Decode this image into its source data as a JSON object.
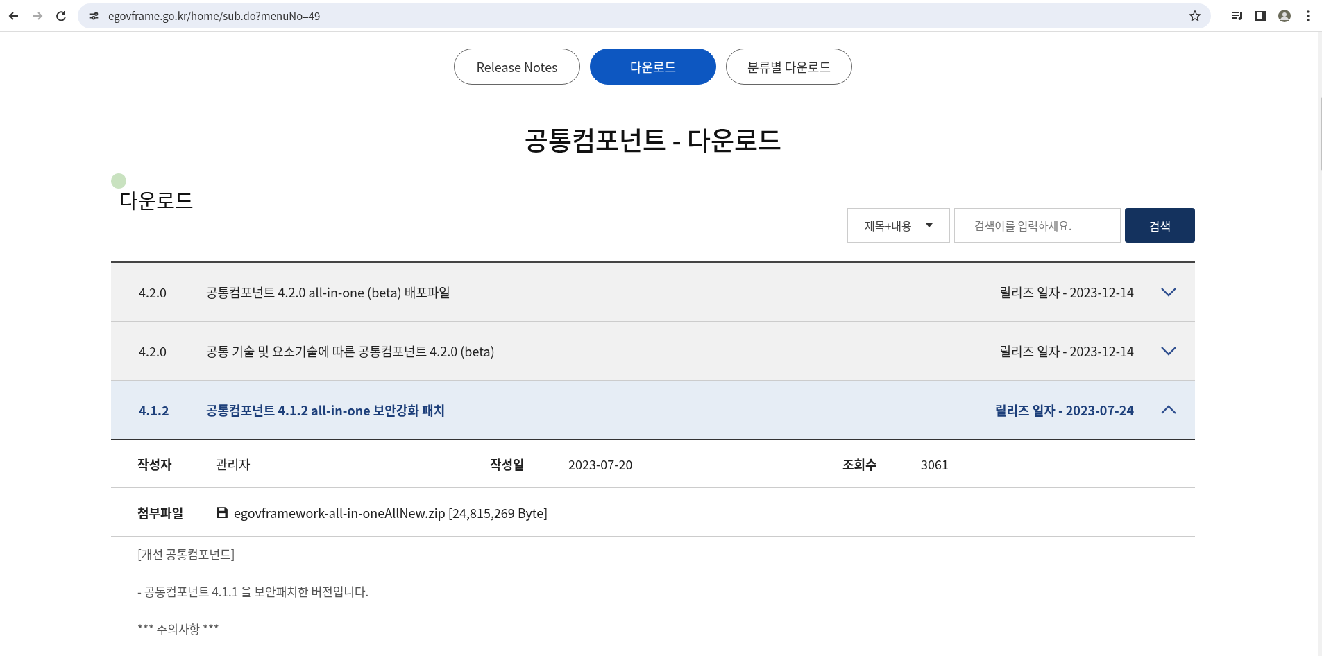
{
  "browser": {
    "url": "egovframe.go.kr/home/sub.do?menuNo=49"
  },
  "tabs": [
    {
      "label": "Release Notes",
      "selected": false
    },
    {
      "label": "다운로드",
      "selected": true
    },
    {
      "label": "분류별 다운로드",
      "selected": false
    }
  ],
  "page_title": "공통컴포넌트 - 다운로드",
  "section_title": "다운로드",
  "search": {
    "scope": "제목+내용",
    "placeholder": "검색어를 입력하세요.",
    "button": "검색"
  },
  "releases": [
    {
      "version": "4.2.0",
      "title": "공통컴포넌트 4.2.0 all-in-one (beta) 배포파일",
      "date": "릴리즈 일자 - 2023-12-14",
      "expanded": false
    },
    {
      "version": "4.2.0",
      "title": "공통 기술 및 요소기술에 따른 공통컴포넌트 4.2.0 (beta)",
      "date": "릴리즈 일자 - 2023-12-14",
      "expanded": false
    },
    {
      "version": "4.1.2",
      "title": "공통컴포넌트 4.1.2 all-in-one 보안강화 패치",
      "date": "릴리즈 일자 - 2023-07-24",
      "expanded": true
    }
  ],
  "detail": {
    "meta": [
      {
        "label": "작성자",
        "value": "관리자"
      },
      {
        "label": "작성일",
        "value": "2023-07-20"
      },
      {
        "label": "조회수",
        "value": "3061"
      }
    ],
    "attachment_label": "첨부파일",
    "attachment": "egovframework-all-in-oneAllNew.zip [24,815,269 Byte]",
    "body": [
      "[개선 공통컴포넌트]",
      "- 공통컴포넌트 4.1.1 을 보안패치한 버전입니다.",
      "*** 주의사항 ***"
    ]
  }
}
